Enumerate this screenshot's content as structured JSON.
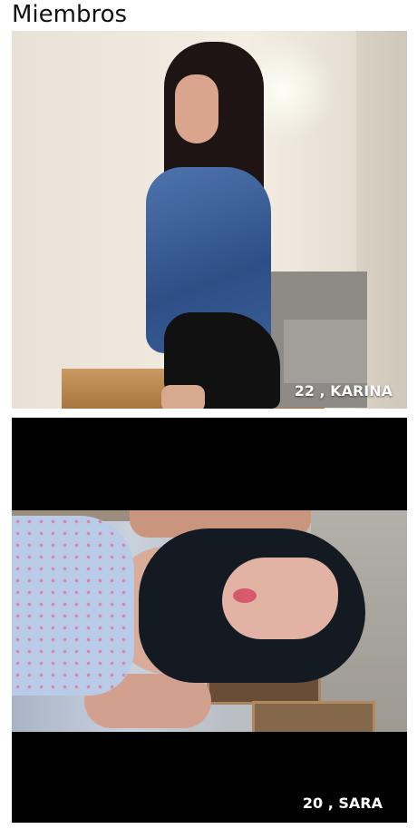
{
  "header": {
    "title": "Miembros"
  },
  "members": [
    {
      "age": "22",
      "name": "KARINA",
      "label": "22 , KARINA"
    },
    {
      "age": "20",
      "name": "SARA",
      "label": "20 , SARA"
    }
  ],
  "colors": {
    "background": "#ffffff",
    "label_text": "#ffffff",
    "card_letterbox": "#000000"
  }
}
